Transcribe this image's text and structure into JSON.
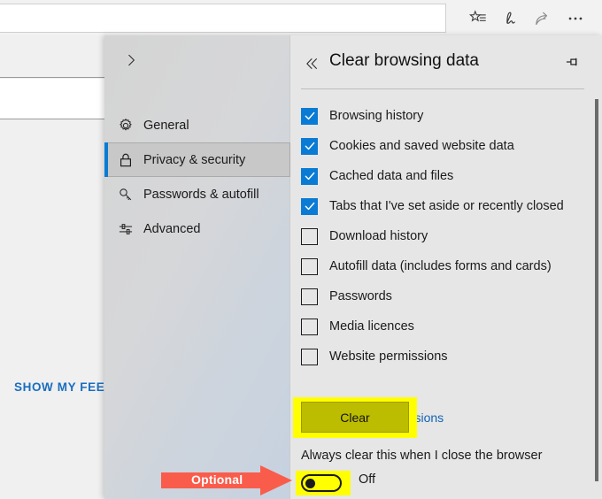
{
  "browser": {
    "address_bar_value": "",
    "address_bar_placeholder": "",
    "toolbar_icons": [
      {
        "name": "favorites-reading-list-icon",
        "label": "Favourites, reading list, history and downloads"
      },
      {
        "name": "notes-pen-icon",
        "label": "Make a Web Note"
      },
      {
        "name": "share-icon",
        "label": "Share"
      },
      {
        "name": "more-ellipsis-icon",
        "label": "Settings and more"
      }
    ]
  },
  "page": {
    "show_my_feed": "SHOW MY FEED"
  },
  "settings": {
    "expand_icon": "chevron-right-icon",
    "nav": [
      {
        "label": "General",
        "icon": "gear-icon",
        "selected": false
      },
      {
        "label": "Privacy & security",
        "icon": "lock-icon",
        "selected": true
      },
      {
        "label": "Passwords & autofill",
        "icon": "key-icon",
        "selected": false
      },
      {
        "label": "Advanced",
        "icon": "sliders-icon",
        "selected": false
      }
    ],
    "pane": {
      "back_icon": "double-chevron-left-icon",
      "title": "Clear browsing data",
      "pin_icon": "pin-icon",
      "checkboxes": [
        {
          "label": "Browsing history",
          "checked": true
        },
        {
          "label": "Cookies and saved website data",
          "checked": true
        },
        {
          "label": "Cached data and files",
          "checked": true
        },
        {
          "label": "Tabs that I've set aside or recently closed",
          "checked": true
        },
        {
          "label": "Download history",
          "checked": false
        },
        {
          "label": "Autofill data (includes forms and cards)",
          "checked": false
        },
        {
          "label": "Passwords",
          "checked": false
        },
        {
          "label": "Media licences",
          "checked": false
        },
        {
          "label": "Website permissions",
          "checked": false
        }
      ],
      "manage_permissions_link": "Manage permissions",
      "clear_button": "Clear",
      "always_clear_label": "Always clear this when I close the browser",
      "toggle_state": "Off"
    }
  },
  "annotations": {
    "arrow_label": "Optional",
    "arrow_color": "#fa5c4b",
    "highlight_color": "#ffff00",
    "clear_button_color": "#bcbc00",
    "accent_color": "#0a7bd4",
    "link_color": "#1263b5"
  }
}
